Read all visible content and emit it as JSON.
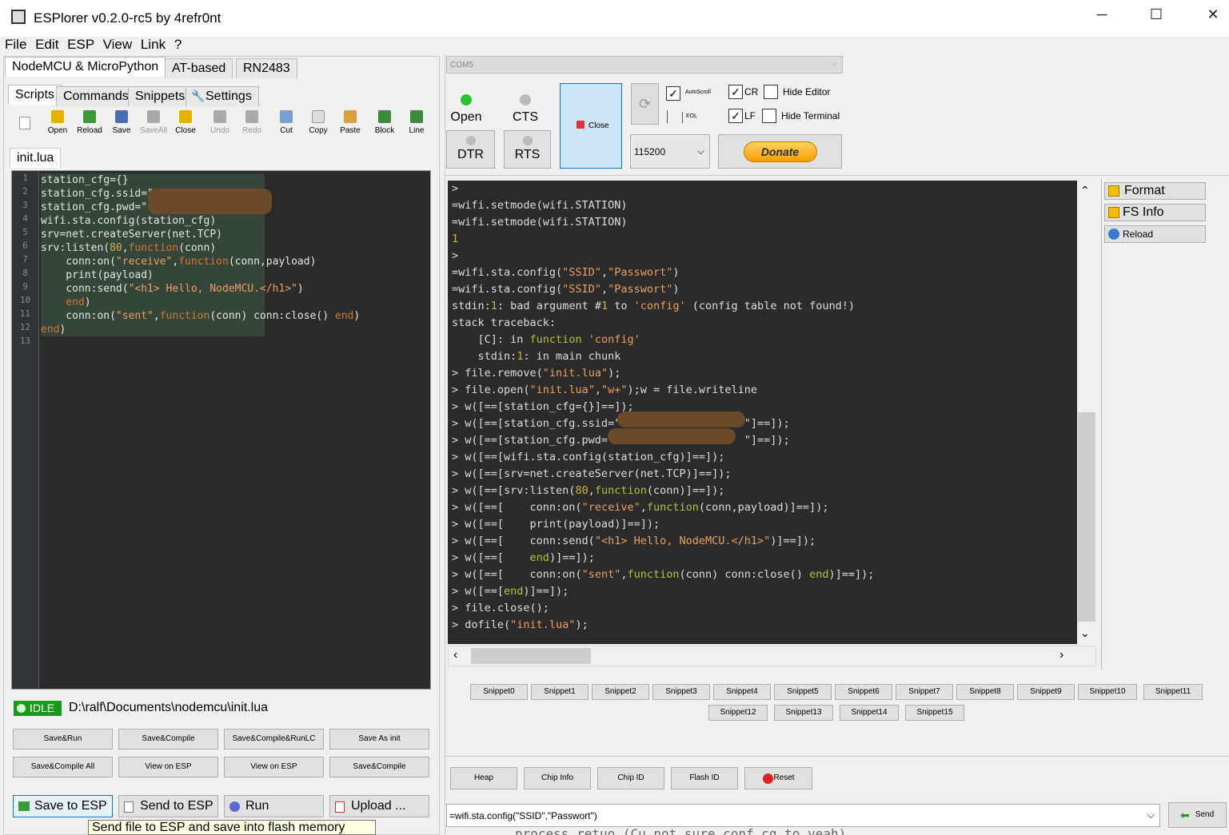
{
  "window": {
    "title": "ESPlorer v0.2.0-rc5 by 4refr0nt",
    "minimize": "─",
    "maximize": "☐",
    "close": "✕"
  },
  "menu": [
    "File",
    "Edit",
    "ESP",
    "View",
    "Link",
    "?"
  ],
  "main_tabs": [
    "NodeMCU & MicroPython",
    "AT-based",
    "RN2483"
  ],
  "sub_tabs": [
    "Scripts",
    "Commands",
    "Snippets",
    "Settings"
  ],
  "toolbar": [
    "Open",
    "Reload",
    "Save",
    "SaveAll",
    "Close",
    "Undo",
    "Redo",
    "Cut",
    "Copy",
    "Paste",
    "Block",
    "Line"
  ],
  "file_tab": "init.lua",
  "line_numbers": [
    "1",
    "2",
    "3",
    "4",
    "5",
    "6",
    "7",
    "8",
    "9",
    "10",
    "11",
    "12",
    "13"
  ],
  "code_lines": [
    [
      {
        "t": "station_cfg={}",
        "c": ""
      }
    ],
    [
      {
        "t": "station_cfg.ssid=\"",
        "c": ""
      },
      {
        "t": "                 \"",
        "c": "str"
      }
    ],
    [
      {
        "t": "station_cfg.pwd=\"",
        "c": ""
      },
      {
        "t": "",
        "c": "str"
      }
    ],
    [
      {
        "t": "wifi.sta.config(station_cfg)",
        "c": ""
      }
    ],
    [
      {
        "t": "srv=net.createServer(net.TCP)",
        "c": ""
      }
    ],
    [
      {
        "t": "srv:listen(",
        "c": ""
      },
      {
        "t": "80",
        "c": "num"
      },
      {
        "t": ",",
        "c": ""
      },
      {
        "t": "function",
        "c": "kw"
      },
      {
        "t": "(conn)",
        "c": ""
      }
    ],
    [
      {
        "t": "    conn:on(",
        "c": ""
      },
      {
        "t": "\"receive\"",
        "c": "str"
      },
      {
        "t": ",",
        "c": ""
      },
      {
        "t": "function",
        "c": "kw"
      },
      {
        "t": "(conn,payload)",
        "c": ""
      }
    ],
    [
      {
        "t": "    print(payload)",
        "c": ""
      }
    ],
    [
      {
        "t": "    conn:send(",
        "c": ""
      },
      {
        "t": "\"<h1> Hello, NodeMCU.</h1>\"",
        "c": "str"
      },
      {
        "t": ")",
        "c": ""
      }
    ],
    [
      {
        "t": "    end",
        "c": "kw"
      },
      {
        "t": ")",
        "c": ""
      }
    ],
    [
      {
        "t": "    conn:on(",
        "c": ""
      },
      {
        "t": "\"sent\"",
        "c": "str"
      },
      {
        "t": ",",
        "c": ""
      },
      {
        "t": "function",
        "c": "kw"
      },
      {
        "t": "(conn) conn:close() ",
        "c": ""
      },
      {
        "t": "end",
        "c": "kw"
      },
      {
        "t": ")",
        "c": ""
      }
    ],
    [
      {
        "t": "end",
        "c": "kw"
      },
      {
        "t": ")",
        "c": ""
      }
    ],
    [
      {
        "t": "",
        "c": ""
      }
    ]
  ],
  "status": {
    "badge": "IDLE",
    "path": "D:\\ralf\\Documents\\nodemcu\\init.lua"
  },
  "bottom_buttons": [
    "Save&Run",
    "Save&Compile",
    "Save&Compile&RunLC",
    "Save As init",
    "Save&Compile All",
    "View on ESP",
    "View on ESP",
    "Save&Compile"
  ],
  "main_buttons": [
    "Save to ESP",
    "Send to ESP",
    "Run",
    "Upload ..."
  ],
  "tooltip": "Send file to ESP and save into flash memory",
  "port": "COM5",
  "conn": {
    "open": "Open",
    "cts": "CTS",
    "dtr": "DTR",
    "rts": "RTS",
    "close": "Close"
  },
  "opts": {
    "autoscroll": "AutoScroll",
    "eol": "EOL",
    "cr": "CR",
    "lf": "LF",
    "hide_editor": "Hide Editor",
    "hide_terminal": "Hide Terminal"
  },
  "baud": "115200",
  "donate": "Donate",
  "side_buttons": [
    "Format",
    "FS Info",
    "Reload"
  ],
  "terminal_lines": [
    [
      {
        "t": ">",
        "c": ""
      }
    ],
    [
      {
        "t": "=wifi.setmode(wifi.STATION)",
        "c": ""
      }
    ],
    [
      {
        "t": "=wifi.setmode(wifi.STATION)",
        "c": ""
      }
    ],
    [
      {
        "t": "1",
        "c": "num2"
      }
    ],
    [
      {
        "t": ">",
        "c": ""
      }
    ],
    [
      {
        "t": "=wifi.sta.config(",
        "c": ""
      },
      {
        "t": "\"SSID\"",
        "c": "str"
      },
      {
        "t": ",",
        "c": ""
      },
      {
        "t": "\"Passwort\"",
        "c": "str"
      },
      {
        "t": ")",
        "c": ""
      }
    ],
    [
      {
        "t": "=wifi.sta.config(",
        "c": ""
      },
      {
        "t": "\"SSID\"",
        "c": "str"
      },
      {
        "t": ",",
        "c": ""
      },
      {
        "t": "\"Passwort\"",
        "c": "str"
      },
      {
        "t": ")",
        "c": ""
      }
    ],
    [
      {
        "t": "stdin:",
        "c": ""
      },
      {
        "t": "1",
        "c": "num2"
      },
      {
        "t": ": bad argument #",
        "c": ""
      },
      {
        "t": "1",
        "c": "num2"
      },
      {
        "t": " to ",
        "c": ""
      },
      {
        "t": "'config'",
        "c": "str"
      },
      {
        "t": " (config table not found!)",
        "c": ""
      }
    ],
    [
      {
        "t": "stack traceback:",
        "c": ""
      }
    ],
    [
      {
        "t": "    [C]: in ",
        "c": ""
      },
      {
        "t": "function",
        "c": "kw2"
      },
      {
        "t": " ",
        "c": ""
      },
      {
        "t": "'config'",
        "c": "str"
      }
    ],
    [
      {
        "t": "    stdin:",
        "c": ""
      },
      {
        "t": "1",
        "c": "num2"
      },
      {
        "t": ": in main chunk",
        "c": ""
      }
    ],
    [
      {
        "t": "> file.remove(",
        "c": ""
      },
      {
        "t": "\"init.lua\"",
        "c": "str"
      },
      {
        "t": ");",
        "c": ""
      }
    ],
    [
      {
        "t": "> file.open(",
        "c": ""
      },
      {
        "t": "\"init.lua\"",
        "c": "str"
      },
      {
        "t": ",",
        "c": ""
      },
      {
        "t": "\"w+\"",
        "c": "str"
      },
      {
        "t": ");w = file.writeline",
        "c": ""
      }
    ],
    [
      {
        "t": "> w([==[station_cfg={}]==]);",
        "c": ""
      }
    ],
    [
      {
        "t": "> w([==[station_cfg.ssid=\"",
        "c": ""
      },
      {
        "t": "                   ",
        "c": ""
      },
      {
        "t": "\"]==]);",
        "c": ""
      }
    ],
    [
      {
        "t": "> w([==[station_cfg.pwd=\"",
        "c": ""
      },
      {
        "t": "                    ",
        "c": ""
      },
      {
        "t": "\"]==]);",
        "c": ""
      }
    ],
    [
      {
        "t": "> w([==[wifi.sta.config(station_cfg)]==]);",
        "c": ""
      }
    ],
    [
      {
        "t": "> w([==[srv=net.createServer(net.TCP)]==]);",
        "c": ""
      }
    ],
    [
      {
        "t": "> w([==[srv:listen(",
        "c": ""
      },
      {
        "t": "80",
        "c": "num2"
      },
      {
        "t": ",",
        "c": ""
      },
      {
        "t": "function",
        "c": "kw2"
      },
      {
        "t": "(conn)]==]);",
        "c": ""
      }
    ],
    [
      {
        "t": "> w([==[    conn:on(",
        "c": ""
      },
      {
        "t": "\"receive\"",
        "c": "str"
      },
      {
        "t": ",",
        "c": ""
      },
      {
        "t": "function",
        "c": "kw2"
      },
      {
        "t": "(conn,payload)]==]);",
        "c": ""
      }
    ],
    [
      {
        "t": "> w([==[    print(payload)]==]);",
        "c": ""
      }
    ],
    [
      {
        "t": "> w([==[    conn:send(",
        "c": ""
      },
      {
        "t": "\"<h1> Hello, NodeMCU.</h1>\"",
        "c": "str"
      },
      {
        "t": ")]==]);",
        "c": ""
      }
    ],
    [
      {
        "t": "> w([==[    ",
        "c": ""
      },
      {
        "t": "end",
        "c": "kw2"
      },
      {
        "t": ")]==]);",
        "c": ""
      }
    ],
    [
      {
        "t": "> w([==[    conn:on(",
        "c": ""
      },
      {
        "t": "\"sent\"",
        "c": "str"
      },
      {
        "t": ",",
        "c": ""
      },
      {
        "t": "function",
        "c": "kw2"
      },
      {
        "t": "(conn) conn:close() ",
        "c": ""
      },
      {
        "t": "end",
        "c": "kw2"
      },
      {
        "t": ")]==]);",
        "c": ""
      }
    ],
    [
      {
        "t": "> w([==[",
        "c": ""
      },
      {
        "t": "end",
        "c": "kw2"
      },
      {
        "t": ")]==]);",
        "c": ""
      }
    ],
    [
      {
        "t": "> file.close();",
        "c": ""
      }
    ],
    [
      {
        "t": "> dofile(",
        "c": ""
      },
      {
        "t": "\"init.lua\"",
        "c": "str"
      },
      {
        "t": ");",
        "c": ""
      }
    ],
    [
      {
        "t": "",
        "c": ""
      }
    ],
    [
      {
        "t": ">",
        "c": ""
      }
    ]
  ],
  "snippets": [
    "Snippet0",
    "Snippet1",
    "Snippet2",
    "Snippet3",
    "Snippet4",
    "Snippet5",
    "Snippet6",
    "Snippet7",
    "Snippet8",
    "Snippet9",
    "Snippet10",
    "Snippet11",
    "Snippet12",
    "Snippet13",
    "Snippet14",
    "Snippet15"
  ],
  "esp_buttons": [
    "Heap",
    "Chip Info",
    "Chip ID",
    "Flash ID",
    "Reset"
  ],
  "command_input": "=wifi.sta.config(\"SSID\",\"Passwort\")",
  "send": "Send",
  "background_text": "process retuo (Cu not sure conf.cg to yeah)",
  "colors": {
    "accent": "#cce4f7",
    "idle": "#1a9a1a",
    "donate": "#f7b500"
  }
}
